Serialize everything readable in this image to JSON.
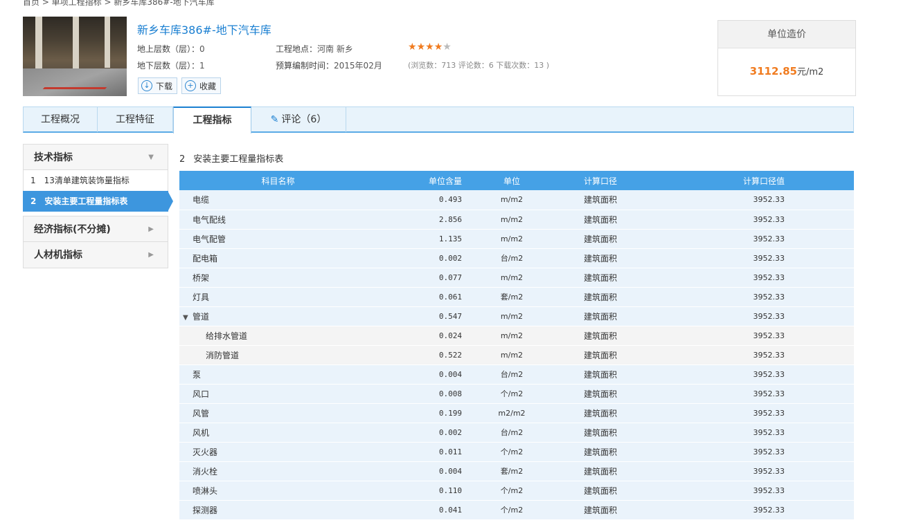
{
  "breadcrumb": "首页 > 单项工程指标 > 新乡车库386#-地下汽车库",
  "project": {
    "title": "新乡车库386#-地下汽车库",
    "floors_above_label": "地上层数（层）：",
    "floors_above": "0",
    "floors_below_label": "地下层数（层）：",
    "floors_below": "1",
    "location_label": "工程地点：",
    "location": "河南 新乡",
    "budget_time_label": "预算编制时间：",
    "budget_time": "2015年02月",
    "rating": 4,
    "rating_max": 5,
    "stats": "(浏览数：713  评论数：6  下载次数：13 )",
    "download_label": "下载",
    "favorite_label": "收藏"
  },
  "price": {
    "header": "单位造价",
    "value": "3112.85",
    "unit": "元/m2"
  },
  "tabs": [
    {
      "label": "工程概况"
    },
    {
      "label": "工程特征"
    },
    {
      "label": "工程指标"
    },
    {
      "label": "评论（6）"
    }
  ],
  "sidebar": {
    "tech_header": "技术指标",
    "items": [
      {
        "no": "1",
        "label": "13清单建筑装饰量指标"
      },
      {
        "no": "2",
        "label": "安装主要工程量指标表"
      }
    ],
    "econ_header": "经济指标(不分摊)",
    "labor_header": "人材机指标"
  },
  "table": {
    "no": "2",
    "title": "安装主要工程量指标表",
    "headers": [
      "科目名称",
      "单位含量",
      "单位",
      "计算口径",
      "计算口径值"
    ],
    "rows": [
      {
        "name": "电缆",
        "qty": "0.493",
        "unit": "m/m2",
        "calc": "建筑面积",
        "val": "3952.33"
      },
      {
        "name": "电气配线",
        "qty": "2.856",
        "unit": "m/m2",
        "calc": "建筑面积",
        "val": "3952.33"
      },
      {
        "name": "电气配管",
        "qty": "1.135",
        "unit": "m/m2",
        "calc": "建筑面积",
        "val": "3952.33"
      },
      {
        "name": "配电箱",
        "qty": "0.002",
        "unit": "台/m2",
        "calc": "建筑面积",
        "val": "3952.33"
      },
      {
        "name": "桥架",
        "qty": "0.077",
        "unit": "m/m2",
        "calc": "建筑面积",
        "val": "3952.33"
      },
      {
        "name": "灯具",
        "qty": "0.061",
        "unit": "套/m2",
        "calc": "建筑面积",
        "val": "3952.33"
      },
      {
        "name": "管道",
        "qty": "0.547",
        "unit": "m/m2",
        "calc": "建筑面积",
        "val": "3952.33"
      },
      {
        "name": "给排水管道",
        "qty": "0.024",
        "unit": "m/m2",
        "calc": "建筑面积",
        "val": "3952.33"
      },
      {
        "name": "消防管道",
        "qty": "0.522",
        "unit": "m/m2",
        "calc": "建筑面积",
        "val": "3952.33"
      },
      {
        "name": "泵",
        "qty": "0.004",
        "unit": "台/m2",
        "calc": "建筑面积",
        "val": "3952.33"
      },
      {
        "name": "风口",
        "qty": "0.008",
        "unit": "个/m2",
        "calc": "建筑面积",
        "val": "3952.33"
      },
      {
        "name": "风管",
        "qty": "0.199",
        "unit": "m2/m2",
        "calc": "建筑面积",
        "val": "3952.33"
      },
      {
        "name": "风机",
        "qty": "0.002",
        "unit": "台/m2",
        "calc": "建筑面积",
        "val": "3952.33"
      },
      {
        "name": "灭火器",
        "qty": "0.011",
        "unit": "个/m2",
        "calc": "建筑面积",
        "val": "3952.33"
      },
      {
        "name": "消火栓",
        "qty": "0.004",
        "unit": "套/m2",
        "calc": "建筑面积",
        "val": "3952.33"
      },
      {
        "name": "喷淋头",
        "qty": "0.110",
        "unit": "个/m2",
        "calc": "建筑面积",
        "val": "3952.33"
      },
      {
        "name": "探测器",
        "qty": "0.041",
        "unit": "个/m2",
        "calc": "建筑面积",
        "val": "3952.33"
      }
    ]
  },
  "colors": {
    "accent": "#1a7fd1",
    "table_header": "#45a1e6",
    "price": "#f07b1f",
    "row_bg": "#eaf3fb"
  }
}
